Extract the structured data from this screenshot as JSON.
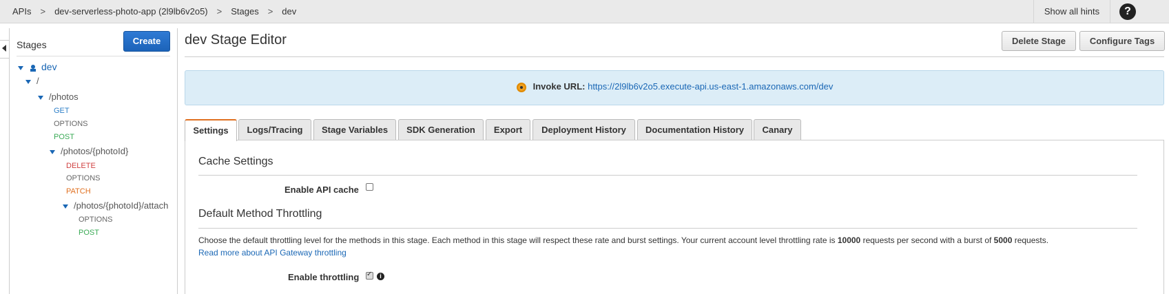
{
  "breadcrumb": {
    "items": [
      "APIs",
      "dev-serverless-photo-app (2l9lb6v2o5)",
      "Stages",
      "dev"
    ],
    "separator": ">"
  },
  "header": {
    "show_hints": "Show all hints",
    "help": "?"
  },
  "stages_panel": {
    "title": "Stages",
    "create_label": "Create",
    "tree": {
      "stage": "dev",
      "root": "/",
      "photos": "/photos",
      "photos_methods": [
        "GET",
        "OPTIONS",
        "POST"
      ],
      "photo_id": "/photos/{photoId}",
      "photo_id_methods": [
        "DELETE",
        "OPTIONS",
        "PATCH"
      ],
      "attach": "/photos/{photoId}/attach",
      "attach_methods": [
        "OPTIONS",
        "POST"
      ]
    }
  },
  "editor": {
    "title": "dev Stage Editor",
    "delete_stage": "Delete Stage",
    "configure_tags": "Configure Tags",
    "invoke_label": "Invoke URL:",
    "invoke_url": "https://2l9lb6v2o5.execute-api.us-east-1.amazonaws.com/dev",
    "tabs": [
      "Settings",
      "Logs/Tracing",
      "Stage Variables",
      "SDK Generation",
      "Export",
      "Deployment History",
      "Documentation History",
      "Canary"
    ],
    "active_tab": "Settings"
  },
  "settings": {
    "cache_title": "Cache Settings",
    "enable_cache_label": "Enable API cache",
    "enable_cache_checked": false,
    "throttling_title": "Default Method Throttling",
    "throttling_desc_1": "Choose the default throttling level for the methods in this stage. Each method in this stage will respect these rate and burst settings. Your current account level throttling rate is ",
    "rate": "10000",
    "throttling_desc_2": " requests per second with a burst of ",
    "burst": "5000",
    "throttling_desc_3": " requests.",
    "read_more": "Read more about API Gateway throttling",
    "enable_throttling_label": "Enable throttling",
    "enable_throttling_checked": true
  }
}
